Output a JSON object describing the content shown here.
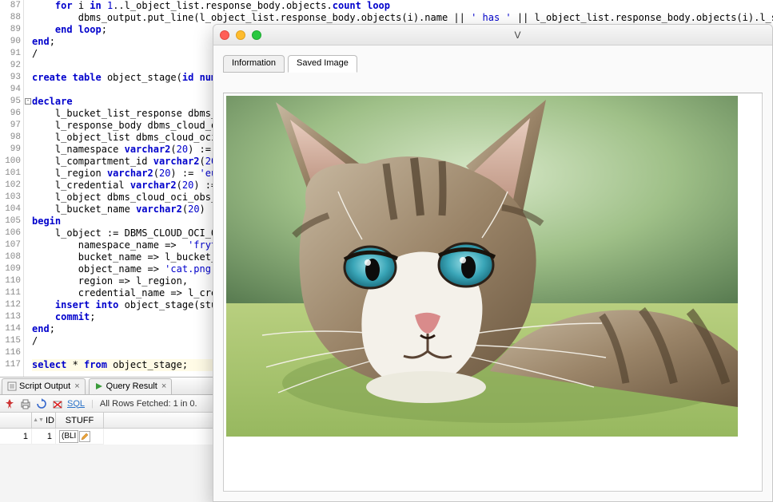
{
  "editor": {
    "first_line_number": 87,
    "lines": [
      {
        "indent": 4,
        "tokens": [
          [
            "kw",
            "for"
          ],
          [
            "ident",
            " i "
          ],
          [
            "kw",
            "in"
          ],
          [
            "ident",
            " "
          ],
          [
            "num",
            "1"
          ],
          [
            "ident",
            ".."
          ],
          [
            "ident",
            "l_object_list.response_body.objects."
          ],
          [
            "kw",
            "count"
          ],
          [
            "ident",
            " "
          ],
          [
            "kw",
            "loop"
          ]
        ]
      },
      {
        "indent": 8,
        "tokens": [
          [
            "ident",
            "dbms_output.put_line(l_object_list.response_body.objects(i).name || "
          ],
          [
            "str",
            "' has '"
          ],
          [
            "ident",
            " || l_object_list.response_body.objects(i).l_size"
          ]
        ]
      },
      {
        "indent": 4,
        "tokens": [
          [
            "kw",
            "end"
          ],
          [
            "ident",
            " "
          ],
          [
            "kw",
            "loop"
          ],
          [
            "ident",
            ";"
          ]
        ]
      },
      {
        "indent": 0,
        "tokens": [
          [
            "kw",
            "end"
          ],
          [
            "ident",
            ";"
          ]
        ]
      },
      {
        "indent": 0,
        "tokens": [
          [
            "ident",
            "/"
          ]
        ]
      },
      {
        "indent": 0,
        "tokens": []
      },
      {
        "indent": 0,
        "tokens": [
          [
            "kw",
            "create"
          ],
          [
            "ident",
            " "
          ],
          [
            "kw",
            "table"
          ],
          [
            "ident",
            " object_stage("
          ],
          [
            "kw",
            "id"
          ],
          [
            "ident",
            " "
          ],
          [
            "kw",
            "num"
          ]
        ]
      },
      {
        "indent": 0,
        "tokens": []
      },
      {
        "indent": 0,
        "fold": true,
        "tokens": [
          [
            "kw",
            "declare"
          ]
        ]
      },
      {
        "indent": 4,
        "tokens": [
          [
            "ident",
            "l_bucket_list_response dbms_c"
          ]
        ]
      },
      {
        "indent": 4,
        "tokens": [
          [
            "ident",
            "l_response_body dbms_cloud_oc"
          ]
        ]
      },
      {
        "indent": 4,
        "tokens": [
          [
            "ident",
            "l_object_list dbms_cloud_oci_"
          ]
        ]
      },
      {
        "indent": 4,
        "tokens": [
          [
            "ident",
            "l_namespace "
          ],
          [
            "kw",
            "varchar2"
          ],
          [
            "ident",
            "("
          ],
          [
            "num",
            "20"
          ],
          [
            "ident",
            ") := "
          ],
          [
            "str",
            "'"
          ]
        ]
      },
      {
        "indent": 4,
        "tokens": [
          [
            "ident",
            "l_compartment_id "
          ],
          [
            "kw",
            "varchar2"
          ],
          [
            "ident",
            "("
          ],
          [
            "num",
            "200"
          ]
        ]
      },
      {
        "indent": 4,
        "tokens": [
          [
            "ident",
            "l_region "
          ],
          [
            "kw",
            "varchar2"
          ],
          [
            "ident",
            "("
          ],
          [
            "num",
            "20"
          ],
          [
            "ident",
            ") := "
          ],
          [
            "str",
            "'eu-"
          ]
        ]
      },
      {
        "indent": 4,
        "tokens": [
          [
            "ident",
            "l_credential "
          ],
          [
            "kw",
            "varchar2"
          ],
          [
            "ident",
            "("
          ],
          [
            "num",
            "20"
          ],
          [
            "ident",
            ") := "
          ]
        ]
      },
      {
        "indent": 4,
        "tokens": [
          [
            "ident",
            "l_object dbms_cloud_oci_obs_o"
          ]
        ]
      },
      {
        "indent": 4,
        "tokens": [
          [
            "ident",
            "l_bucket_name "
          ],
          [
            "kw",
            "varchar2"
          ],
          [
            "ident",
            "("
          ],
          [
            "num",
            "20"
          ],
          [
            "ident",
            ") :="
          ]
        ]
      },
      {
        "indent": 0,
        "tokens": [
          [
            "kw",
            "begin"
          ]
        ]
      },
      {
        "indent": 4,
        "tokens": [
          [
            "ident",
            "l_object := DBMS_CLOUD_OCI_O"
          ]
        ]
      },
      {
        "indent": 8,
        "tokens": [
          [
            "ident",
            "namespace_name =>  "
          ],
          [
            "str",
            "'frytqg"
          ]
        ]
      },
      {
        "indent": 8,
        "tokens": [
          [
            "ident",
            "bucket_name => l_bucket_na"
          ]
        ]
      },
      {
        "indent": 8,
        "tokens": [
          [
            "ident",
            "object_name => "
          ],
          [
            "str",
            "'cat.png'"
          ],
          [
            "ident",
            ","
          ]
        ]
      },
      {
        "indent": 8,
        "tokens": [
          [
            "ident",
            "region => l_region,"
          ]
        ]
      },
      {
        "indent": 8,
        "tokens": [
          [
            "ident",
            "credential_name => l_crede"
          ]
        ]
      },
      {
        "indent": 4,
        "tokens": [
          [
            "kw",
            "insert"
          ],
          [
            "ident",
            " "
          ],
          [
            "kw",
            "into"
          ],
          [
            "ident",
            " object_stage(stu"
          ]
        ]
      },
      {
        "indent": 4,
        "tokens": [
          [
            "kw",
            "commit"
          ],
          [
            "ident",
            ";"
          ]
        ]
      },
      {
        "indent": 0,
        "tokens": [
          [
            "kw",
            "end"
          ],
          [
            "ident",
            ";"
          ]
        ]
      },
      {
        "indent": 0,
        "tokens": [
          [
            "ident",
            "/"
          ]
        ]
      },
      {
        "indent": 0,
        "tokens": []
      },
      {
        "indent": 0,
        "highlight": true,
        "tokens": [
          [
            "kw",
            "select"
          ],
          [
            "ident",
            " * "
          ],
          [
            "kw",
            "from"
          ],
          [
            "ident",
            " object_stage;"
          ]
        ]
      }
    ]
  },
  "bottom": {
    "tabs": {
      "script_output": "Script Output",
      "query_result": "Query Result"
    },
    "sql_link": "SQL",
    "status": "All Rows Fetched: 1 in 0.",
    "grid": {
      "headers": {
        "id": "ID",
        "stuff": "STUFF"
      },
      "row": {
        "rownum": "1",
        "id": "1",
        "blob": "(BLI"
      }
    }
  },
  "viewer": {
    "title": "V",
    "tabs": {
      "information": "Information",
      "saved_image": "Saved Image"
    }
  }
}
